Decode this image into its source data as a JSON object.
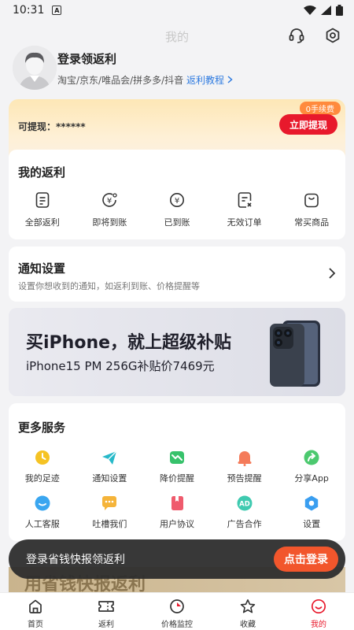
{
  "status_bar": {
    "time": "10:31",
    "notification_glyph": "A"
  },
  "header": {
    "title": "我的"
  },
  "profile": {
    "name": "登录领返利",
    "platforms": "淘宝/京东/唯品会/拼多多/抖音",
    "tutorial_link": "返利教程"
  },
  "cash": {
    "label": "可提现：",
    "amount": "******",
    "fee_tag": "0手续费",
    "withdraw_button": "立即提现"
  },
  "my_rebate": {
    "title": "我的返利",
    "items": [
      {
        "label": "全部返利",
        "icon": "document-icon"
      },
      {
        "label": "即将到账",
        "icon": "yuan-clock-icon"
      },
      {
        "label": "已到账",
        "icon": "yuan-check-icon"
      },
      {
        "label": "无效订单",
        "icon": "document-x-icon"
      },
      {
        "label": "常买商品",
        "icon": "bag-icon"
      }
    ]
  },
  "notify": {
    "title": "通知设置",
    "desc": "设置你想收到的通知，如返利到账、价格提醒等"
  },
  "banner": {
    "headline": "买iPhone，就上超级补贴",
    "subline": "iPhone15 PM 256G补贴价7469元"
  },
  "more_services": {
    "title": "更多服务",
    "rows": [
      [
        {
          "label": "我的足迹",
          "icon": "clock-icon",
          "color": "#f5c324"
        },
        {
          "label": "通知设置",
          "icon": "paper-plane-icon",
          "color": "#27b9c9"
        },
        {
          "label": "降价提醒",
          "icon": "price-down-icon",
          "color": "#37c26b"
        },
        {
          "label": "预告提醒",
          "icon": "bell-icon",
          "color": "#f47b5a"
        },
        {
          "label": "分享App",
          "icon": "share-icon",
          "color": "#4cc96f"
        }
      ],
      [
        {
          "label": "人工客服",
          "icon": "chat-bubble-icon",
          "color": "#3aa6f0"
        },
        {
          "label": "吐槽我们",
          "icon": "comment-icon",
          "color": "#f5b43a"
        },
        {
          "label": "用户协议",
          "icon": "book-icon",
          "color": "#ef5b6d"
        },
        {
          "label": "广告合作",
          "icon": "ad-icon",
          "color": "#3fcab0"
        },
        {
          "label": "设置",
          "icon": "settings-icon",
          "color": "#3a9ef0"
        }
      ]
    ]
  },
  "promo_strip": {
    "text": "用省钱快报返利"
  },
  "login_bar": {
    "text": "登录省钱快报领返利",
    "button": "点击登录"
  },
  "tabbar": {
    "tabs": [
      {
        "label": "首页",
        "icon": "home-icon",
        "active": false
      },
      {
        "label": "返利",
        "icon": "ticket-icon",
        "active": false
      },
      {
        "label": "价格监控",
        "icon": "price-monitor-icon",
        "active": false
      },
      {
        "label": "收藏",
        "icon": "star-icon",
        "active": false
      },
      {
        "label": "我的",
        "icon": "smiley-icon",
        "active": true
      }
    ],
    "active_color": "#e8192c"
  }
}
